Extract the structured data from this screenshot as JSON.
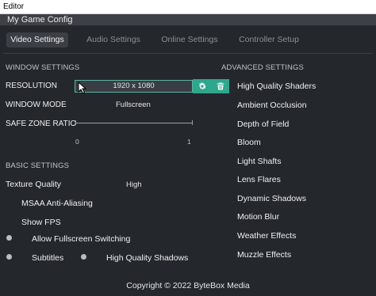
{
  "window": {
    "title": "Editor"
  },
  "app": {
    "title": "My Game Config"
  },
  "tabs": [
    {
      "label": "Video Settings",
      "active": true
    },
    {
      "label": "Audio Settings",
      "active": false
    },
    {
      "label": "Online Settings",
      "active": false
    },
    {
      "label": "Controller Setup",
      "active": false
    }
  ],
  "window_settings": {
    "header": "WINDOW SETTINGS",
    "resolution_label": "RESOLUTION",
    "resolution_value": "1920 x 1080",
    "window_mode_label": "WINDOW MODE",
    "window_mode_value": "Fullscreen",
    "safe_zone_label": "SAFE ZONE RATIO",
    "safe_zone_min": "0",
    "safe_zone_max": "1"
  },
  "basic_settings": {
    "header": "BASIC SETTINGS",
    "texture_quality_label": "Texture Quality",
    "texture_quality_value": "High",
    "msaa_label": "MSAA Anti-Aliasing",
    "show_fps_label": "Show FPS",
    "allow_fullscreen_label": "Allow Fullscreen Switching",
    "subtitles_label": "Subtitles",
    "high_quality_shadows_label": "High Quality Shadows"
  },
  "advanced_settings": {
    "header": "ADVANCED SETTINGS",
    "items": [
      "High Quality Shaders",
      "Ambient Occlusion",
      "Depth of Field",
      "Bloom",
      "Light Shafts",
      "Lens Flares",
      "Dynamic Shadows",
      "Motion Blur",
      "Weather Effects",
      "Muzzle Effects"
    ]
  },
  "icons": {
    "settings": "gear-icon",
    "delete": "trash-icon"
  },
  "colors": {
    "accent": "#2ea78c",
    "background": "#24282d"
  },
  "footer": {
    "copyright": "Copyright © 2022 ByteBox Media"
  }
}
